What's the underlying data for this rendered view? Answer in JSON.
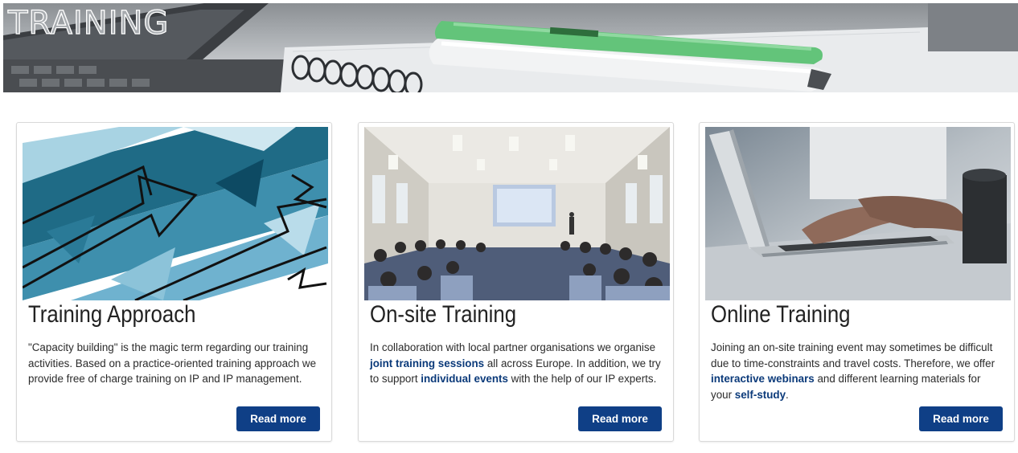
{
  "banner": {
    "title": "TRAINING"
  },
  "cards": [
    {
      "title": "Training Approach",
      "text_parts": [
        "\"Capacity building\" is the magic term regarding our training activities. Based on a practice-oriented training approach we provide free of charge training on IP and IP management."
      ],
      "button": "Read more",
      "image": "arrows-illustration"
    },
    {
      "title": "On-site Training",
      "text_parts": [
        "In collaboration with local partner organisations we organise ",
        "joint training sessions",
        " all across Europe. In addition, we try to support ",
        "individual events",
        " with the help of our IP experts."
      ],
      "button": "Read more",
      "image": "conference-room-photo"
    },
    {
      "title": "Online Training",
      "text_parts": [
        "Joining an on-site training event may sometimes be difficult due to time-constraints and travel costs. Therefore, we offer ",
        "interactive webinars",
        " and different learning materials for your ",
        "self-study",
        "."
      ],
      "button": "Read more",
      "image": "laptop-typing-photo"
    }
  ],
  "colors": {
    "button_bg": "#0f3f86",
    "link_text": "#0b3a7a",
    "accent_marker": "#63c47a"
  }
}
